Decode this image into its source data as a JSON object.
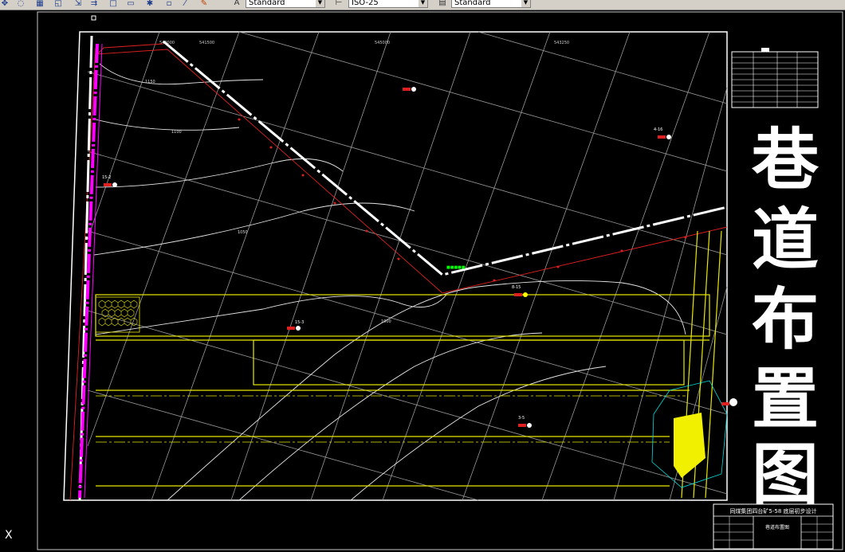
{
  "toolbar": {
    "icons": [
      "move-icon",
      "orbit-icon",
      "save-icon",
      "zoom-extents-icon",
      "zoom-window-icon",
      "zoom-previous-icon",
      "box-icon",
      "box2-icon",
      "gear-icon",
      "pan-icon",
      "match-properties-icon"
    ],
    "text_style": "Standard",
    "dim_style": "ISO-25",
    "table_style": "Standard"
  },
  "drawing": {
    "grid_labels": [
      "540000",
      "541500",
      "545000",
      "543250"
    ],
    "big_title": [
      "巷",
      "道",
      "布",
      "置",
      "图"
    ],
    "title_block_header": "同煤集团四台矿5-58 底层初步设计",
    "title_block_name": "巷道布置图",
    "contour_labels": [
      "1150",
      "1100",
      "1050",
      "1000"
    ],
    "borehole_labels": [
      "15-2",
      "15-3",
      "8-15",
      "4-16",
      "3-5"
    ],
    "ucs_label": "X"
  }
}
